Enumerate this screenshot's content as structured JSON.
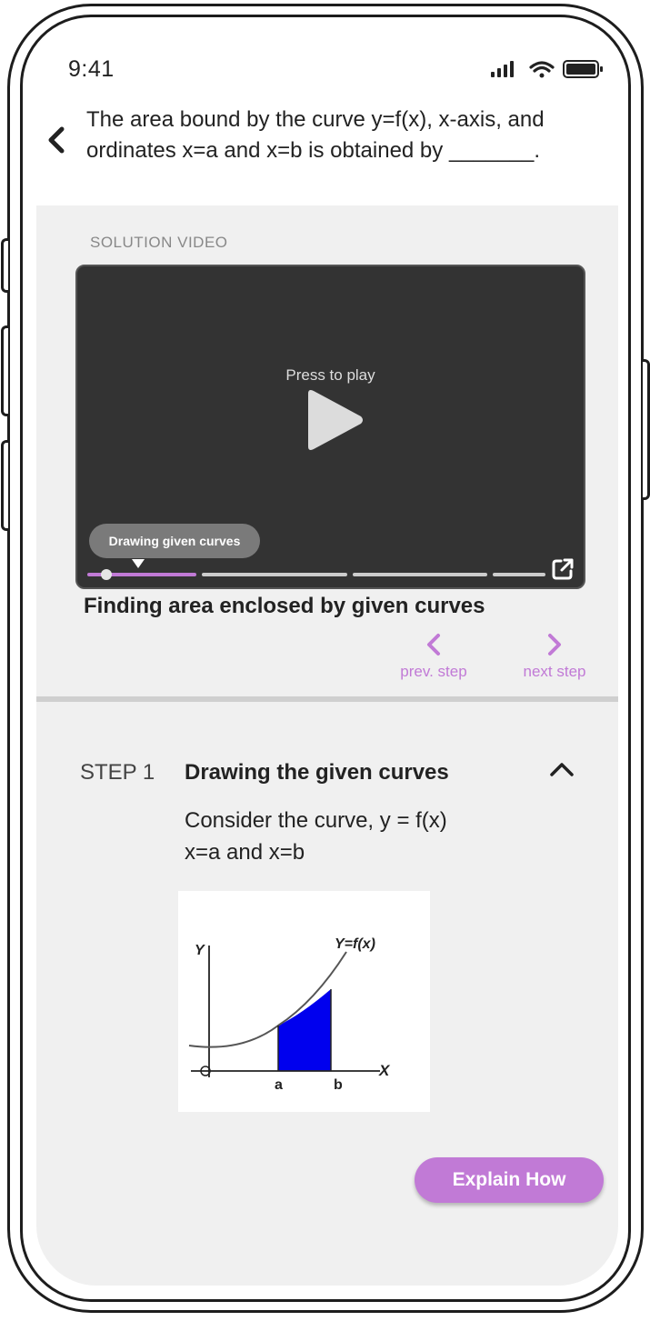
{
  "status_bar": {
    "time": "9:41",
    "icons": [
      "signal-icon",
      "wifi-icon",
      "battery-icon"
    ]
  },
  "header": {
    "back_icon": "chevron-left-icon",
    "question": "The area bound by the curve y=f(x), x-axis, and ordinates x=a and x=b is obtained by _______."
  },
  "solution": {
    "section_label": "SOLUTION VIDEO",
    "video": {
      "overlay_text": "Press to play",
      "current_chapter_tooltip": "Drawing given curves",
      "title": "Finding area enclosed by given curves"
    },
    "nav": {
      "prev_label": "prev. step",
      "next_label": "next step"
    }
  },
  "step": {
    "number_label": "STEP 1",
    "title": "Drawing the given curves",
    "body_line1": "Consider the curve, y = f(x)",
    "body_line2": "x=a and x=b",
    "figure": {
      "y_axis_label": "Y",
      "x_axis_label": "X",
      "curve_label": "Y=f(x)",
      "a_label": "a",
      "b_label": "b"
    }
  },
  "explain_button": "Explain How",
  "colors": {
    "accent": "#c17ad6",
    "video_bg": "#333333",
    "section_bg": "#f0f0f0",
    "shaded_area": "#0000ee"
  }
}
